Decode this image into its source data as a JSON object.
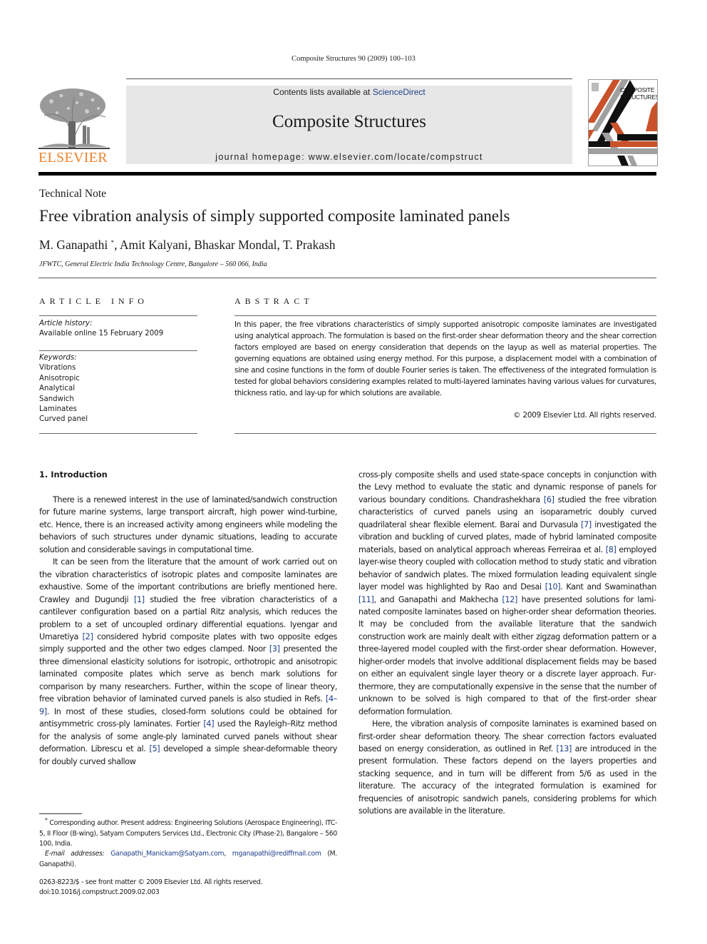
{
  "running_head": "Composite Structures 90 (2009) 100–103",
  "header": {
    "publisher_logo_text": "ELSEVIER",
    "contents_prefix": "Contents lists available at ",
    "contents_link": "ScienceDirect",
    "journal_title": "Composite Structures",
    "homepage": "journal homepage: www.elsevier.com/locate/compstruct",
    "cover_title_line1": "COMPOSITE",
    "cover_title_line2": "STRUCTURES",
    "colors": {
      "publisher_orange": "#f0822b",
      "link_blue": "#1f3f8a",
      "banner_gray": "#e7e7e7",
      "cover_orange": "#c9522a",
      "cover_gray": "#a0a0a0"
    }
  },
  "article": {
    "type": "Technical Note",
    "title": "Free vibration analysis of simply supported composite laminated panels",
    "authors": {
      "first": "M. Ganapathi",
      "first_mark": "*",
      "rest": ", Amit Kalyani, Bhaskar Mondal, T. Prakash"
    },
    "affiliation": "JFWTC, General Electric India Technology Centre, Bangalore – 560 066, India"
  },
  "article_info": {
    "heading": "ARTICLE INFO",
    "history_label": "Article history:",
    "history_value": "Available online 15 February 2009",
    "keywords_label": "Keywords:",
    "keywords": [
      "Vibrations",
      "Anisotropic",
      "Analytical",
      "Sandwich",
      "Laminates",
      "Curved panel"
    ]
  },
  "abstract": {
    "heading": "ABSTRACT",
    "text": "In this paper, the free vibrations characteristics of simply supported anisotropic composite laminates are investigated using analytical approach. The formulation is based on the first-order shear deformation the­ory and the shear correction factors employed are based on energy consideration that depends on the lay­up as well as material properties. The governing equations are obtained using energy method. For this purpose, a displacement model with a combination of sine and cosine functions in the form of double Fourier series is taken. The effectiveness of the integrated formulation is tested for global behaviors con­sidering examples related to multi-layered laminates having various values for curvatures, thickness ratio, and lay-up for which solutions are available.",
    "copyright": "© 2009 Elsevier Ltd. All rights reserved."
  },
  "body": {
    "section_heading": "1. Introduction",
    "left_paragraphs": [
      [
        {
          "t": "There is a renewed interest in the use of laminated/sandwich construction for future marine systems, large transport aircraft, high power wind-turbine, etc. Hence, there is an increased activity among engineers while modeling the behaviors of such structures under dynamic situations, leading to accurate solution and consid­erable savings in computational time."
        }
      ],
      [
        {
          "t": "It can be seen from the literature that the amount of work car­ried out on the vibration characteristics of isotropic plates and composite laminates are exhaustive. Some of the important contri­butions are briefly mentioned here. Crawley and Dugundji "
        },
        {
          "ref": "[1]"
        },
        {
          "t": " studied the free vibration characteristics of a cantilever configura­tion based on a partial Ritz analysis, which reduces the problem to a set of uncoupled ordinary differential equations. Iyengar and Umaretiya "
        },
        {
          "ref": "[2]"
        },
        {
          "t": " considered hybrid composite plates with two oppo­site edges simply supported and the other two edges clamped. Noor "
        },
        {
          "ref": "[3]"
        },
        {
          "t": " presented the three dimensional elasticity solutions for isotropic, orthotropic and anisotropic laminated composite plates which serve as bench mark solutions for comparison by many researchers. Further, within the scope of linear theory, free vibra­tion behavior of laminated curved panels is also studied in Refs. "
        },
        {
          "ref": "[4–9]"
        },
        {
          "t": ". In most of these studies, closed-form solutions could be ob­tained for antisymmetric cross-ply laminates. Fortier "
        },
        {
          "ref": "[4]"
        },
        {
          "t": " used the Rayleigh–Ritz method for the analysis of some angle-ply laminated curved panels without shear deformation. Librescu et al. "
        },
        {
          "ref": "[5]"
        },
        {
          "t": " devel­oped a simple shear-deformable theory for doubly curved shallow"
        }
      ]
    ],
    "right_paragraphs": [
      [
        {
          "t": "cross-ply composite shells and used state-space concepts in con­junction with the Levy method to evaluate the static and dynamic response of panels for various boundary conditions. Chandrashek­hara "
        },
        {
          "ref": "[6]"
        },
        {
          "t": " studied the free vibration characteristics of curved panels using an isoparametric doubly curved quadrilateral shear flexible element. Barai and Durvasula "
        },
        {
          "ref": "[7]"
        },
        {
          "t": " investigated the vibration and buckling of curved plates, made of hybrid laminated composite materials, based on analytical approach whereas Ferreiraa et al. "
        },
        {
          "ref": "[8]"
        },
        {
          "t": " employed layer-wise theory coupled with collocation method to study static and vibration behavior of sandwich plates. The mixed formulation leading equivalent single layer model was high­lighted by Rao and Desai "
        },
        {
          "ref": "[10]"
        },
        {
          "t": ". Kant and Swaminathan "
        },
        {
          "ref": "[11]"
        },
        {
          "t": ", and Ganapathi and Makhecha "
        },
        {
          "ref": "[12]"
        },
        {
          "t": " have presented solutions for lami­nated composite laminates based on higher-order shear deforma­tion theories. It may be concluded from the available literature that the sandwich construction work are mainly dealt with either zigzag deformation pattern or a three-layered model coupled with the first-order shear deformation. However, higher-order models that involve additional displacement fields may be based on either an equivalent single layer theory or a discrete layer approach. Fur­thermore, they are computationally expensive in the sense that the number of unknown to be solved is high compared to that of the first-order shear deformation formulation."
        }
      ],
      [
        {
          "t": "Here, the vibration analysis of composite laminates is examined based on first-order shear deformation theory. The shear correc­tion factors evaluated based on energy consideration, as outlined in Ref. "
        },
        {
          "ref": "[13]"
        },
        {
          "t": " are introduced in the present formulation. These factors depend on the layers properties and stacking sequence, and in turn will be different from 5/6 as used in the literature. The accuracy of the integrated formulation is examined for frequencies of anisotropic sandwich panels, considering problems for which solutions are available in the literature."
        }
      ]
    ]
  },
  "footnote": {
    "mark": "*",
    "text": " Corresponding author. Present address: Engineering Solutions (Aerospace Engineering), ITC-5, II Floor (B-wing), Satyam Computers Services Ltd., Electronic City (Phase-2), Bangalore – 560 100, India.",
    "email_label": "E-mail addresses:",
    "email1": "Ganapathi_Manickam@Satyam.com",
    "email_sep": ", ",
    "email2": "mganapathi@rediffmail.com",
    "email_owner": " (M. Ganapathi)."
  },
  "front_matter": {
    "issn_line": "0263-8223/$ - see front matter © 2009 Elsevier Ltd. All rights reserved.",
    "doi": "doi:10.1016/j.compstruct.2009.02.003"
  }
}
